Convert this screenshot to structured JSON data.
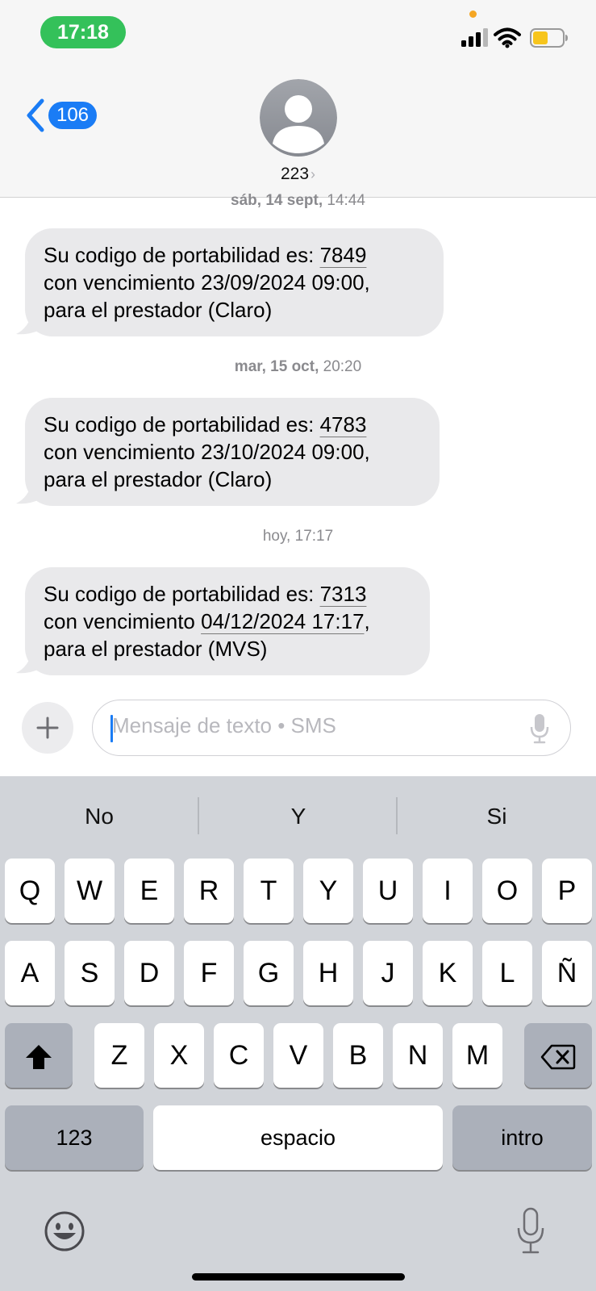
{
  "status_bar": {
    "time": "17:18"
  },
  "header": {
    "back_count": "106",
    "contact": "223"
  },
  "messages": [
    {
      "timestamp_day": "sáb, 14 sept,",
      "timestamp_time": "14:44",
      "pre": "Su codigo de portabilidad es: ",
      "code": "7849",
      "line2_pre": "con vencimiento ",
      "line2_link": "",
      "line2_text": "23/09/2024 09:00,",
      "line3": "para el prestador (Claro)"
    },
    {
      "timestamp_day": "mar, 15 oct,",
      "timestamp_time": "20:20",
      "pre": "Su codigo de portabilidad es: ",
      "code": "4783",
      "line2_pre": "con vencimiento ",
      "line2_link": "",
      "line2_text": "23/10/2024 09:00,",
      "line3": "para el prestador (Claro)"
    },
    {
      "timestamp_day": "hoy,",
      "timestamp_time": "17:17",
      "pre": "Su codigo de portabilidad es: ",
      "code": "7313",
      "line2_pre": "con vencimiento ",
      "line2_link": "04/12/2024 17:17",
      "line2_text": ",",
      "line3": "para el prestador (MVS)"
    }
  ],
  "input": {
    "placeholder": "Mensaje de texto • SMS"
  },
  "keyboard": {
    "suggestions": [
      "No",
      "Y",
      "Si"
    ],
    "row1": [
      "Q",
      "W",
      "E",
      "R",
      "T",
      "Y",
      "U",
      "I",
      "O",
      "P"
    ],
    "row2": [
      "A",
      "S",
      "D",
      "F",
      "G",
      "H",
      "J",
      "K",
      "L",
      "Ñ"
    ],
    "row3": [
      "Z",
      "X",
      "C",
      "V",
      "B",
      "N",
      "M"
    ],
    "numbers_label": "123",
    "space_label": "espacio",
    "return_label": "intro"
  },
  "icons": {
    "back": "chevron-left-icon",
    "avatar": "person-icon",
    "plus": "plus-icon",
    "mic": "microphone-icon",
    "shift": "shift-icon",
    "delete": "delete-icon",
    "emoji": "emoji-icon"
  },
  "colors": {
    "accent": "#1a7cf5",
    "time_pill": "#34c15a",
    "bubble": "#e9e9eb",
    "keyboard_bg": "#d1d4d9"
  }
}
